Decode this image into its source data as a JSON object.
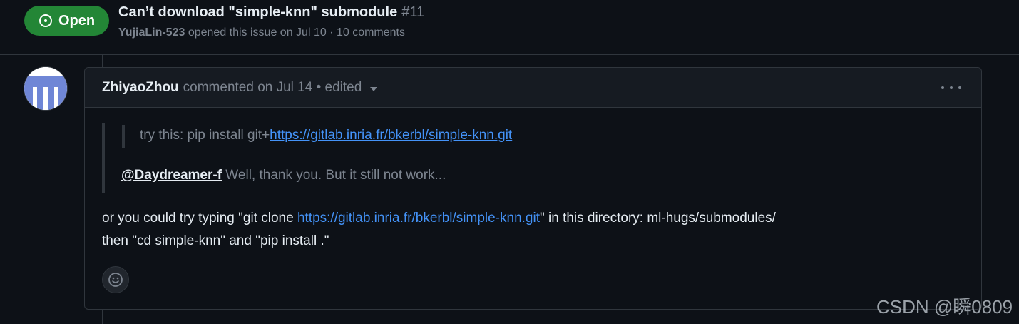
{
  "issue": {
    "state": "Open",
    "state_icon": "issue-opened-icon",
    "title": "Can’t download \"simple-knn\" submodule",
    "number": "#11",
    "author": "YujiaLin-523",
    "meta_text": " opened this issue on Jul 10 · 10 comments",
    "colors": {
      "open_badge": "#238636",
      "link": "#4493f8",
      "background": "#0d1117",
      "header": "#161b22"
    }
  },
  "comment": {
    "author": "ZhiyaoZhou",
    "meta": "commented on Jul 14 • edited",
    "avatar_icon": "identicon-avatar",
    "menu_icon": "kebab-horizontal-icon",
    "quote": {
      "prefix": "try this: pip install git+",
      "link": "https://gitlab.inria.fr/bkerbl/simple-knn.git",
      "mention": "@Daydreamer-f",
      "reply": " Well, thank you. But it still not work..."
    },
    "body": {
      "line1_prefix": "or you could try typing \"git clone ",
      "line1_link": "https://gitlab.inria.fr/bkerbl/simple-knn.git",
      "line1_suffix": "\" in this directory: ml-hugs/submodules/",
      "line2": "then \"cd simple-knn\" and \"pip install .\""
    },
    "reaction_icon": "smiley-icon"
  },
  "watermark": "CSDN @瞬0809"
}
